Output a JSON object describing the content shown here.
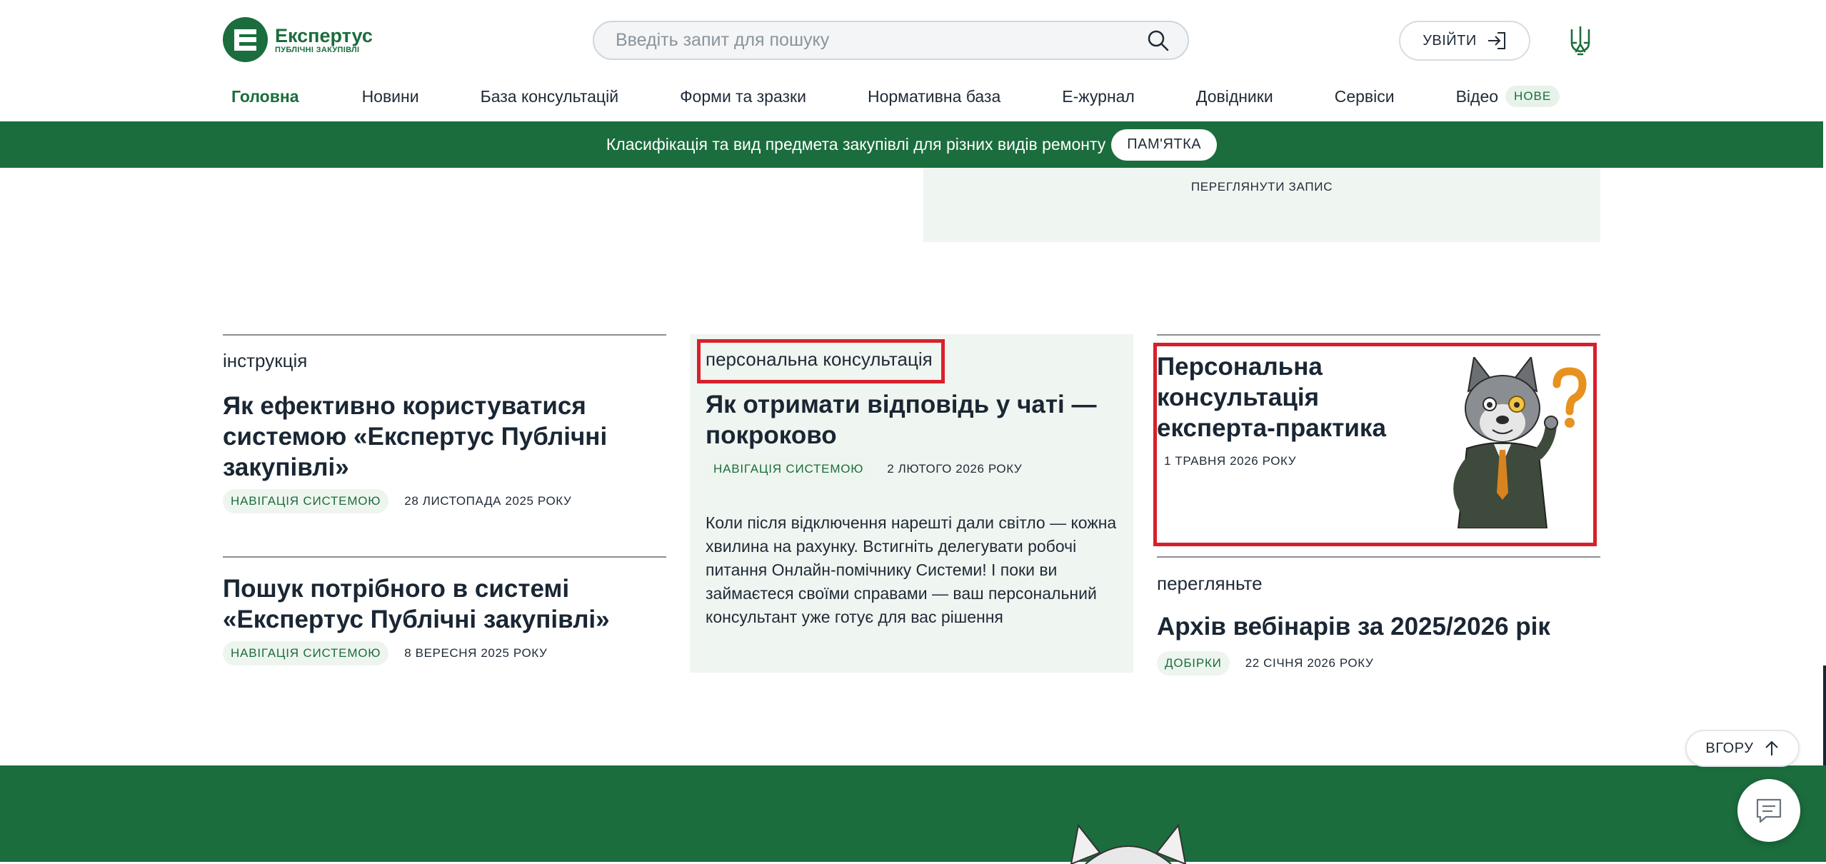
{
  "brand": {
    "name": "Експертус",
    "subtitle": "ПУБЛІЧНІ ЗАКУПІВЛІ",
    "color": "#1b6d3d"
  },
  "search": {
    "placeholder": "Введіть запит для пошуку",
    "icon": "search-icon"
  },
  "header": {
    "login_label": "УВІЙТИ",
    "login_icon": "sign-in-icon",
    "emblem_icon": "trident-icon"
  },
  "nav": {
    "items": [
      {
        "label": "Головна",
        "active": true
      },
      {
        "label": "Новини"
      },
      {
        "label": "База консультацій"
      },
      {
        "label": "Форми та зразки"
      },
      {
        "label": "Нормативна база"
      },
      {
        "label": "Е-журнал"
      },
      {
        "label": "Довідники"
      },
      {
        "label": "Сервіси"
      },
      {
        "label": "Відео",
        "badge": "НОВЕ"
      }
    ]
  },
  "promo": {
    "text": "Класифікація та вид предмета закупівлі для різних видів ремонту",
    "button_label": "ПАМ'ЯТКА"
  },
  "prev_card": {
    "link_label": "ПЕРЕГЛЯНУТИ ЗАПИС"
  },
  "articles": {
    "left": [
      {
        "tag": "інструкція",
        "title": "Як ефективно користуватися системою «Експертус Публічні закупівлі»",
        "category": "НАВІГАЦІЯ СИСТЕМОЮ",
        "date": "28 ЛИСТОПАДА 2025 РОКУ"
      },
      {
        "title": "Пошук потрібного в системі «Експертус Публічні закупівлі»",
        "category": "НАВІГАЦІЯ СИСТЕМОЮ",
        "date": "8 ВЕРЕСНЯ 2025 РОКУ"
      }
    ],
    "middle": {
      "tag": "персональна консультація",
      "title": "Як отримати відповідь у чаті — покроково",
      "category": "НАВІГАЦІЯ СИСТЕМОЮ",
      "date": "2 ЛЮТОГО 2026 РОКУ",
      "excerpt": "Коли після відключення нарешті дали світло — кожна хвилина на рахунку. Встигніть делегувати робочі питання Онлайн-помічнику Системи! І поки ви займаєтеся своїми справами — ваш персональний консультант уже готує для вас рішення"
    },
    "right": [
      {
        "title": "Персональна консультація експерта-практика",
        "date": "1 ТРАВНЯ 2026 РОКУ",
        "image": "wolf-mascot-question"
      },
      {
        "tag": "перегляньте",
        "title": "Архів вебінарів за 2025/2026 рік",
        "category": "ДОБІРКИ",
        "date": "22 СІЧНЯ 2026 РОКУ"
      }
    ]
  },
  "floating": {
    "to_top_label": "ВГОРУ",
    "chat_icon": "chat-icon"
  },
  "highlight_color": "#d8202b"
}
